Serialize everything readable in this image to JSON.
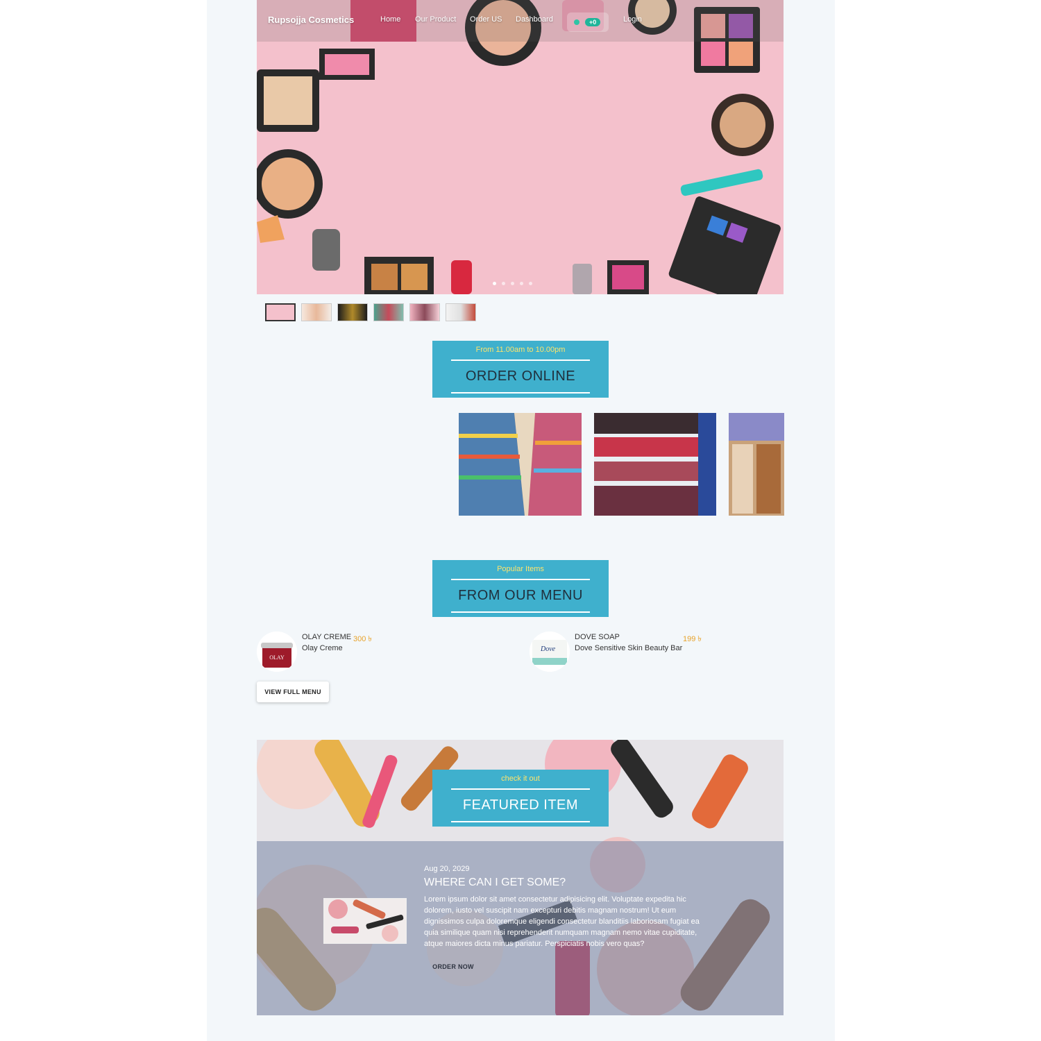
{
  "nav": {
    "brand": "Rupsojja Cosmetics",
    "links": [
      "Home",
      "Our Product",
      "Order US",
      "Dashboard"
    ],
    "cart_badge": "+0",
    "login": "Login"
  },
  "order_section": {
    "subtitle": "From 11.00am to 10.00pm",
    "title": "ORDER ONLINE"
  },
  "menu_section": {
    "subtitle": "Popular Items",
    "title": "FROM OUR MENU",
    "items": [
      {
        "name": "OLAY CREME",
        "price": "300 ৳",
        "desc": "Olay Creme"
      },
      {
        "name": "DOVE SOAP",
        "price": "199 ৳",
        "desc": "Dove Sensitive Skin Beauty Bar"
      }
    ],
    "button": "VIEW FULL MENU"
  },
  "featured_section": {
    "subtitle": "check it out",
    "title": "FEATURED ITEM",
    "date": "Aug 20, 2029",
    "heading": "WHERE CAN I GET SOME?",
    "text": "Lorem ipsum dolor sit amet consectetur adipisicing elit. Voluptate expedita hic dolorem, iusto vel suscipit nam excepturi debitis magnam nostrum! Ut eum dignissimos culpa doloremque eligendi consectetur blanditiis laboriosam fugiat ea quia similique quam nisi reprehenderit numquam magnam nemo vitae cupiditate, atque maiores dicta minus pariatur. Perspiciatis nobis vero quas?",
    "button": "ORDER NOW"
  },
  "colors": {
    "accent": "#3fb0cd",
    "accent_text": "#ffe46b",
    "price": "#e8a32a",
    "badge": "#1fb59a"
  }
}
